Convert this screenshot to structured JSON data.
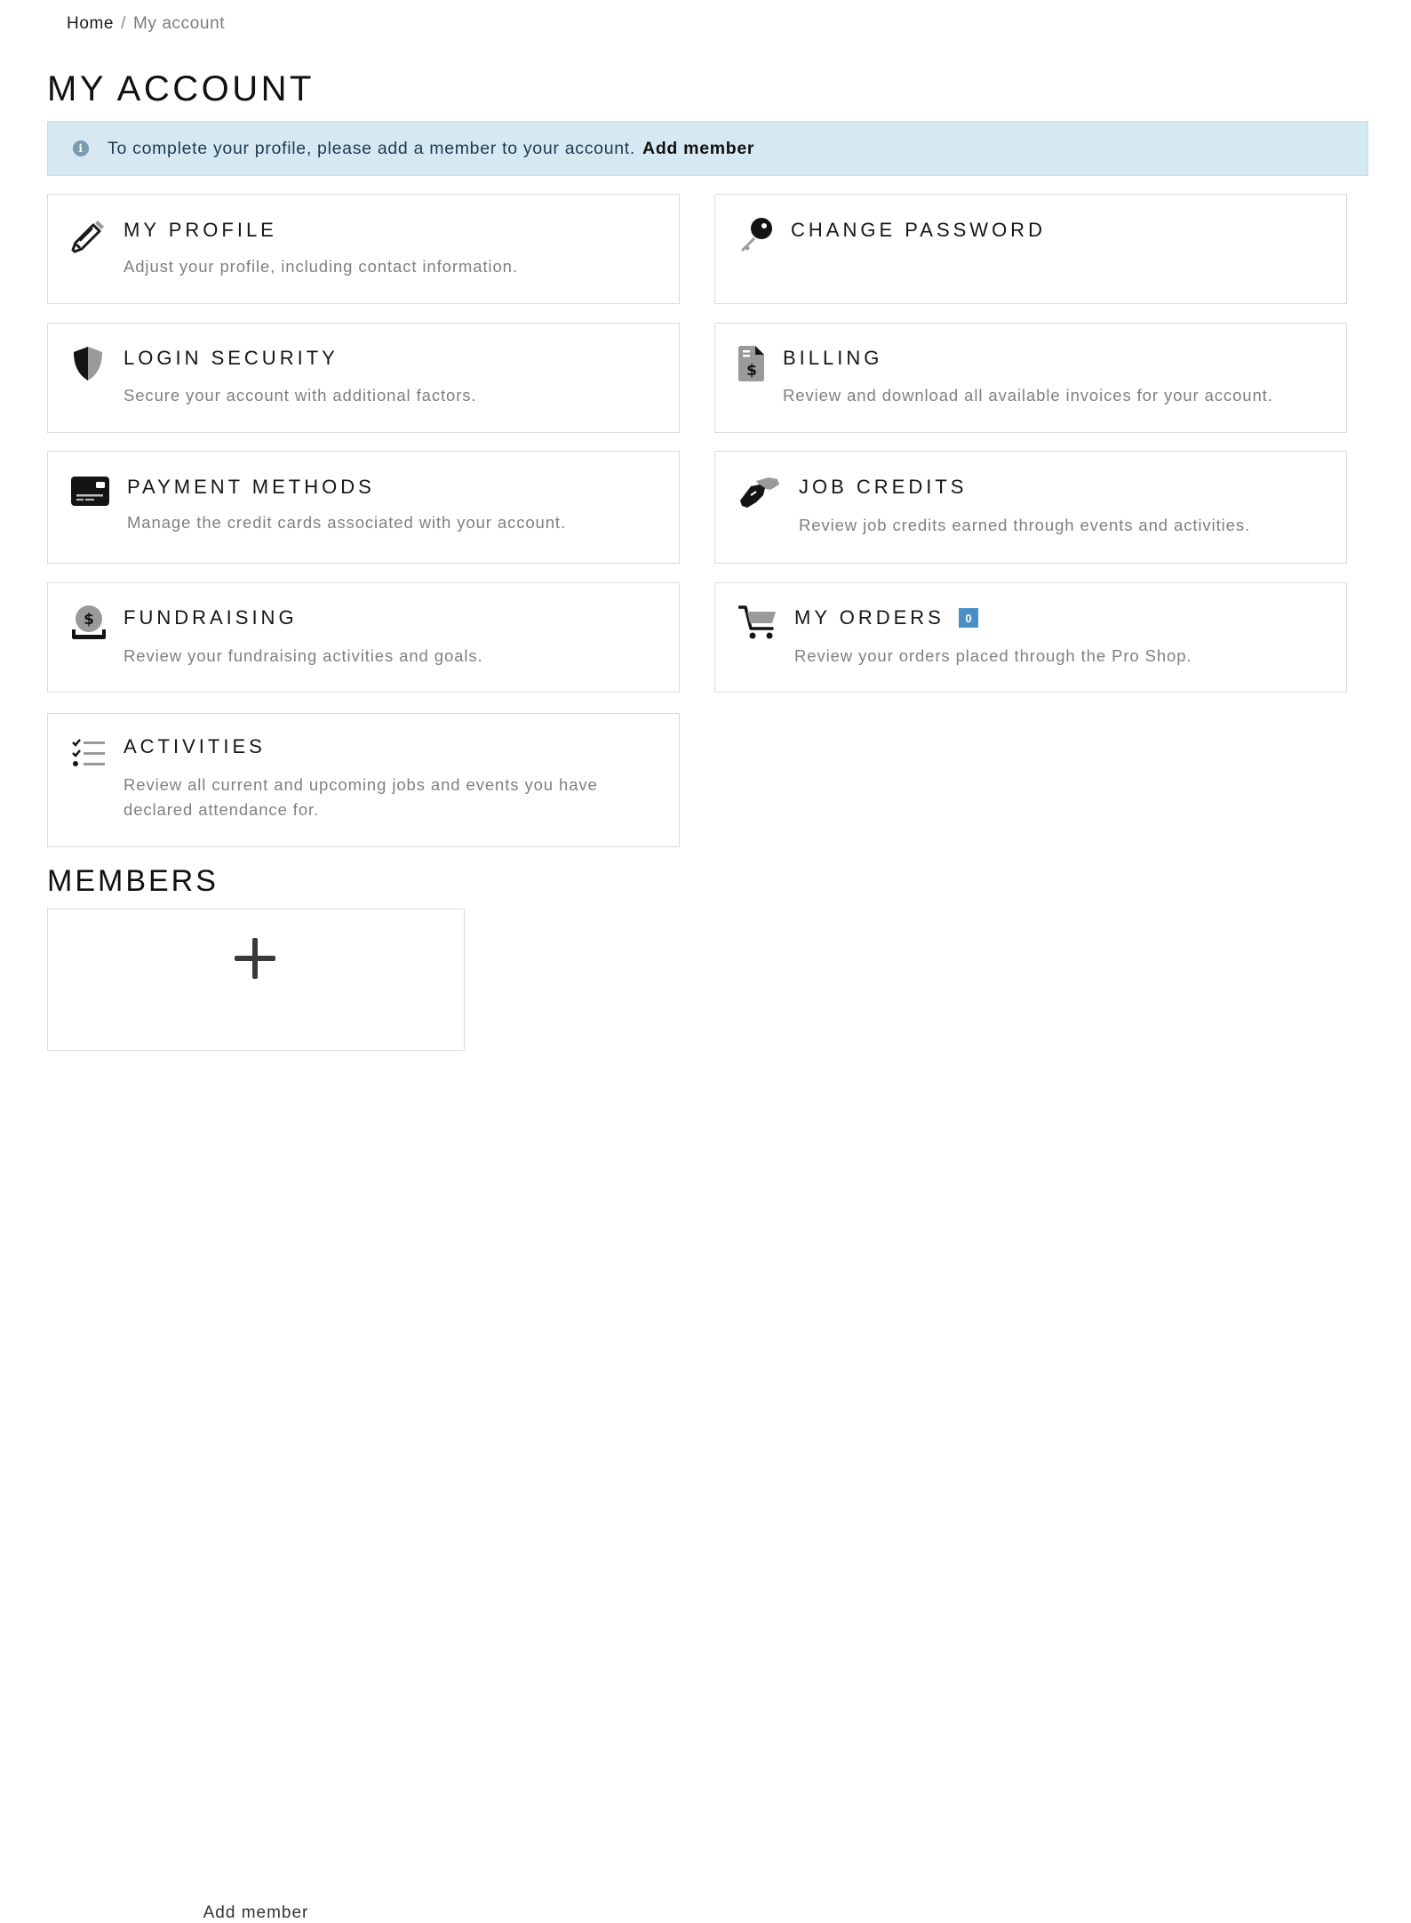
{
  "breadcrumb": {
    "home": "Home",
    "separator": "/",
    "current": "My account"
  },
  "page": {
    "title": "MY ACCOUNT"
  },
  "alert": {
    "message": "To complete your profile, please add a member to your account.",
    "link": "Add member"
  },
  "cards": {
    "profile": {
      "title": "MY PROFILE",
      "description": "Adjust your profile, including contact information.",
      "icon": "pencil-icon"
    },
    "password": {
      "title": "CHANGE PASSWORD",
      "description": "",
      "icon": "key-icon"
    },
    "security": {
      "title": "LOGIN SECURITY",
      "description": "Secure your account with additional factors.",
      "icon": "shield-icon"
    },
    "billing": {
      "title": "BILLING",
      "description": "Review and download all available invoices for your account.",
      "icon": "invoice-dollar-icon"
    },
    "payment": {
      "title": "PAYMENT METHODS",
      "description": "Manage the credit cards associated with your account.",
      "icon": "credit-card-icon"
    },
    "credits": {
      "title": "JOB CREDITS",
      "description": "Review job credits earned through events and activities.",
      "icon": "handshake-icon"
    },
    "fundraising": {
      "title": "FUNDRAISING",
      "description": "Review your fundraising activities and goals.",
      "icon": "donate-icon"
    },
    "orders": {
      "title": "MY ORDERS",
      "badge": "0",
      "description": "Review your orders placed through the Pro Shop.",
      "icon": "cart-icon"
    },
    "activities": {
      "title": "ACTIVITIES",
      "description": "Review all current and upcoming jobs and events you have declared attendance for.",
      "icon": "checklist-icon"
    }
  },
  "members": {
    "title": "MEMBERS",
    "add_label": "Add member",
    "icon": "plus-icon"
  },
  "colors": {
    "alert_bg": "#d6e9f3",
    "badge": "#4a90c8",
    "border": "#dcdcdc"
  }
}
